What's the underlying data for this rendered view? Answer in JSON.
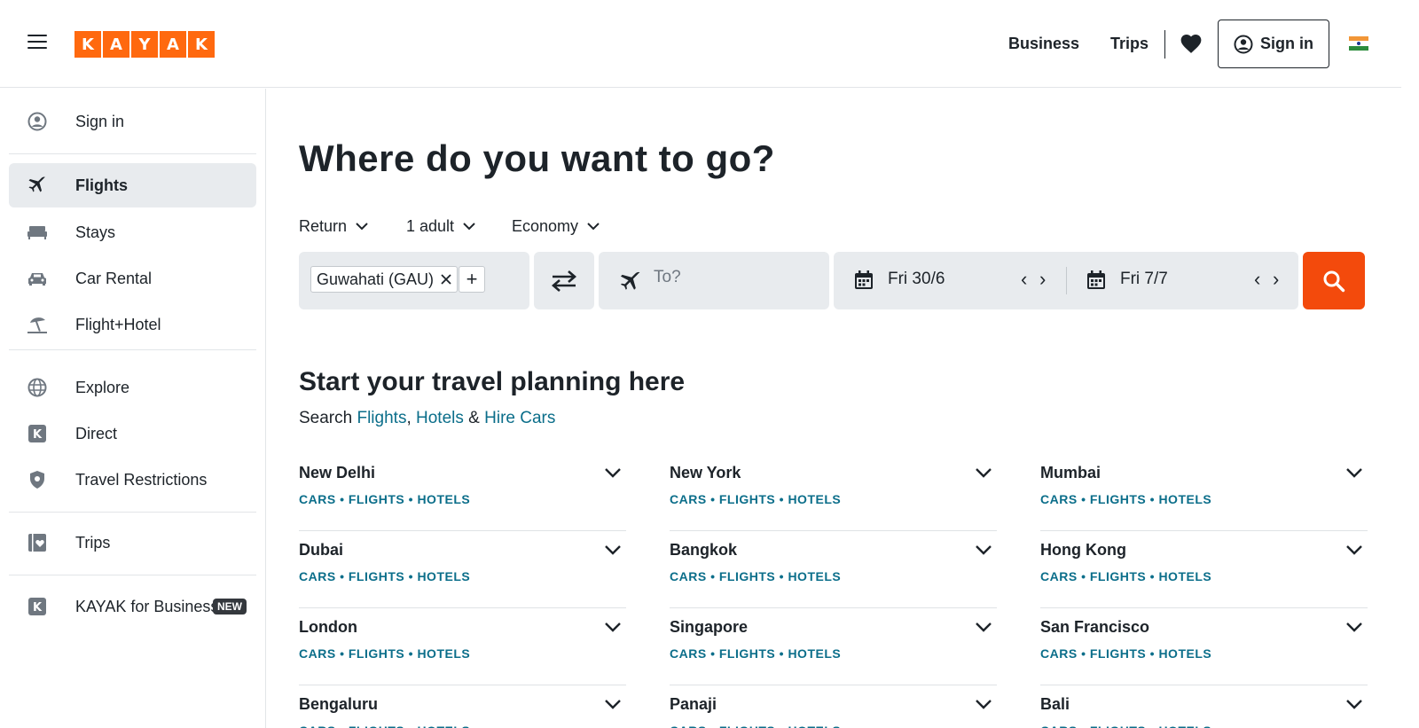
{
  "header": {
    "logo_letters": [
      "K",
      "A",
      "Y",
      "A",
      "K"
    ],
    "business": "Business",
    "trips": "Trips",
    "sign_in": "Sign in",
    "brand_color": "#ff690f"
  },
  "sidebar": {
    "items": [
      {
        "label": "Sign in",
        "icon": "user-circle-icon"
      },
      {
        "label": "Flights",
        "icon": "plane-icon",
        "active": true
      },
      {
        "label": "Stays",
        "icon": "bed-icon"
      },
      {
        "label": "Car Rental",
        "icon": "car-icon"
      },
      {
        "label": "Flight+Hotel",
        "icon": "beach-umbrella-icon"
      },
      {
        "label": "Explore",
        "icon": "globe-icon"
      },
      {
        "label": "Direct",
        "icon": "kayak-k-icon"
      },
      {
        "label": "Travel Restrictions",
        "icon": "shield-icon"
      },
      {
        "label": "Trips",
        "icon": "trips-heart-icon"
      },
      {
        "label": "KAYAK for Business",
        "icon": "kayak-k-icon"
      }
    ],
    "new_badge": "NEW"
  },
  "main": {
    "title": "Where do you want to go?",
    "trip_type": "Return",
    "travellers": "1 adult",
    "cabin": "Economy",
    "origin": "Guwahati (GAU)",
    "destination_placeholder": "To?",
    "depart_date": "Fri 30/6",
    "return_date": "Fri 7/7",
    "search_color": "#f34a0c"
  },
  "planning": {
    "title": "Start your travel planning here",
    "search_prefix": "Search",
    "flights": "Flights",
    "comma": ",",
    "hotels": "Hotels",
    "amp": "&",
    "hire_cars": "Hire Cars"
  },
  "cities": [
    {
      "name": "New Delhi"
    },
    {
      "name": "New York"
    },
    {
      "name": "Mumbai"
    },
    {
      "name": "Dubai"
    },
    {
      "name": "Bangkok"
    },
    {
      "name": "Hong Kong"
    },
    {
      "name": "London"
    },
    {
      "name": "Singapore"
    },
    {
      "name": "San Francisco"
    },
    {
      "name": "Bengaluru"
    },
    {
      "name": "Panaji"
    },
    {
      "name": "Bali"
    }
  ],
  "city_links": {
    "cars": "CARS",
    "flights": "FLIGHTS",
    "hotels": "HOTELS",
    "dot": "•"
  }
}
